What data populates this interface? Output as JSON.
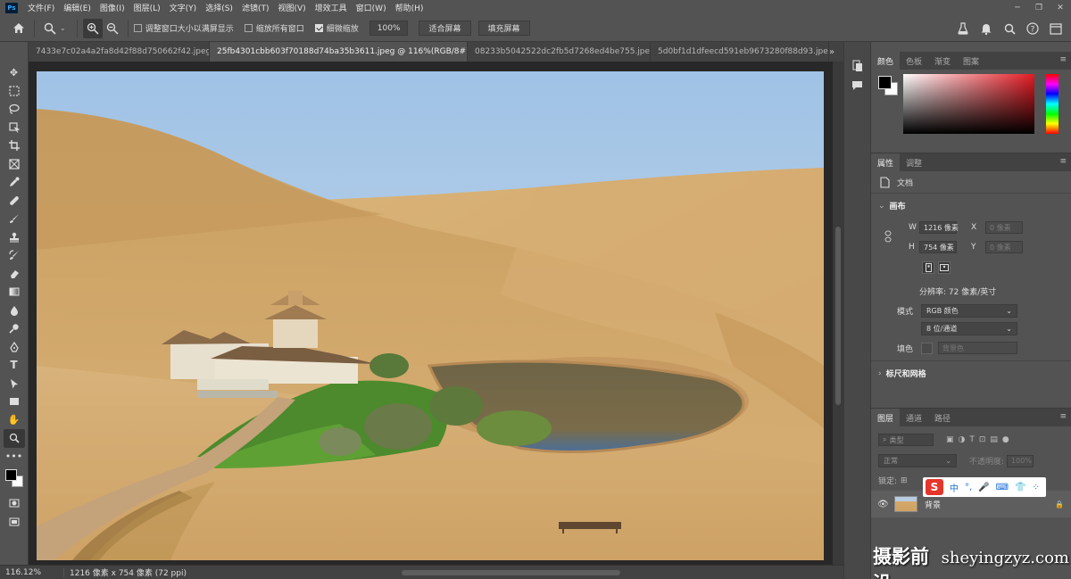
{
  "app": {
    "logo": "Ps"
  },
  "menu": [
    "文件(F)",
    "编辑(E)",
    "图像(I)",
    "图层(L)",
    "文字(Y)",
    "选择(S)",
    "滤镜(T)",
    "视图(V)",
    "增效工具",
    "窗口(W)",
    "帮助(H)"
  ],
  "options": {
    "resize_windows_label": "调整窗口大小以满屏显示",
    "zoom_all_label": "缩放所有窗口",
    "scrubby_zoom_label": "细微缩放",
    "zoom_value": "100%",
    "fit_screen_label": "适合屏幕",
    "fill_screen_label": "填充屏幕"
  },
  "tabs": [
    {
      "label": "7433e7c02a4a2fa8d42f88d750662f42.jpeg"
    },
    {
      "label": "25fb4301cbb603f70188d74ba35b3611.jpeg @ 116%(RGB/8#) *"
    },
    {
      "label": "08233b5042522dc2fb5d7268ed4be755.jpeg"
    },
    {
      "label": "5d0bf1d1dfeecd591eb9673280f88d93.jpe"
    }
  ],
  "status": {
    "zoom": "116.12%",
    "info": "1216 像素 x 754 像素 (72 ppi)"
  },
  "color_panel": {
    "tabs": [
      "颜色",
      "色板",
      "渐变",
      "图案"
    ],
    "fg_color": "#000000",
    "bg_color": "#ffffff"
  },
  "properties": {
    "tabs": [
      "属性",
      "调整"
    ],
    "doc_label": "文档",
    "canvas_title": "画布",
    "w_label": "W",
    "w_value": "1216 像素",
    "h_label": "H",
    "h_value": "754 像素",
    "x_label": "X",
    "x_value": "0 像素",
    "y_label": "Y",
    "y_value": "0 像素",
    "resolution": "分辨率: 72 像素/英寸",
    "mode_label": "模式",
    "mode_value": "RGB 颜色",
    "depth_value": "8 位/通道",
    "fill_label": "填色",
    "fill_value": "背景色",
    "rulers_title": "标尺和网格"
  },
  "layers": {
    "tabs": [
      "图层",
      "通道",
      "路径"
    ],
    "filter_placeholder": "类型",
    "blend_mode": "正常",
    "opacity_label": "不透明度:",
    "opacity_value": "100%",
    "lock_label": "锁定:",
    "layer_name": "背景"
  },
  "ime": {
    "items": [
      "中",
      "°,",
      "🎤",
      "⌨",
      "👕",
      "⁘"
    ]
  },
  "watermark": {
    "cn": "摄影前沿",
    "url": "sheyingzyz.com"
  }
}
